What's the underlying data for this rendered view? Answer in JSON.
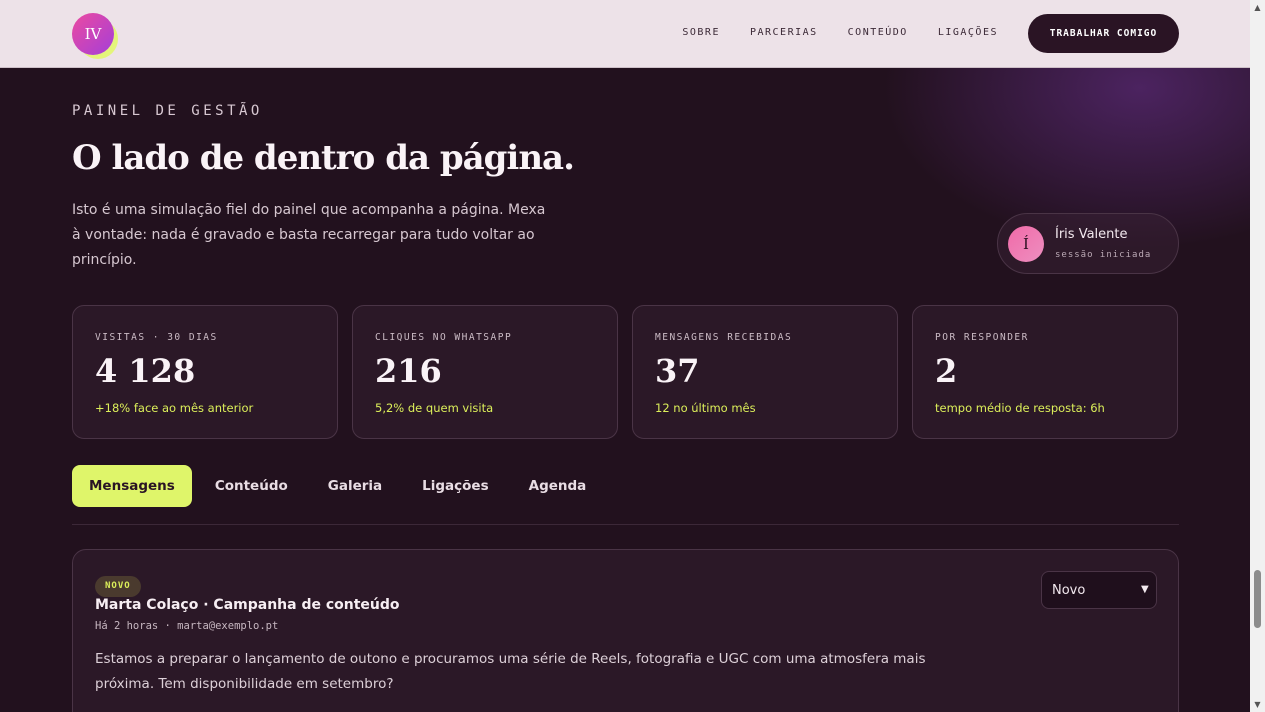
{
  "header": {
    "logo_text": "IV",
    "nav": [
      "SOBRE",
      "PARCERIAS",
      "CONTEÚDO",
      "LIGAÇÕES"
    ],
    "cta_label": "TRABALHAR COMIGO"
  },
  "page": {
    "eyebrow": "PAINEL DE GESTÃO",
    "title": "O lado de dentro da página.",
    "intro": "Isto é uma simulação fiel do painel que acompanha a página. Mexa à vontade: nada é gravado e basta recarregar para tudo voltar ao princípio."
  },
  "session": {
    "initial": "Í",
    "name": "Íris Valente",
    "status": "sessão iniciada"
  },
  "stats": [
    {
      "label": "VISITAS · 30 DIAS",
      "value": "4 128",
      "note": "+18% face ao mês anterior"
    },
    {
      "label": "CLIQUES NO WHATSAPP",
      "value": "216",
      "note": "5,2% de quem visita"
    },
    {
      "label": "MENSAGENS RECEBIDAS",
      "value": "37",
      "note": "12 no último mês"
    },
    {
      "label": "POR RESPONDER",
      "value": "2",
      "note": "tempo médio de resposta: 6h"
    }
  ],
  "tabs": [
    "Mensagens",
    "Conteúdo",
    "Galeria",
    "Ligações",
    "Agenda"
  ],
  "active_tab": "Mensagens",
  "message": {
    "badge": "NOVO",
    "from": "Marta Colaço · Campanha de conteúdo",
    "meta": "Há 2 horas · marta@exemplo.pt",
    "body": "Estamos a preparar o lançamento de outono e procuramos uma série de Reels, fotografia e UGC com uma atmosfera mais próxima. Tem disponibilidade em setembro?",
    "status_selected": "Novo"
  },
  "colors": {
    "accent": "#dff56a",
    "background": "#22111e",
    "header_bg": "#ede2e8",
    "card_bg": "#2b1827"
  }
}
